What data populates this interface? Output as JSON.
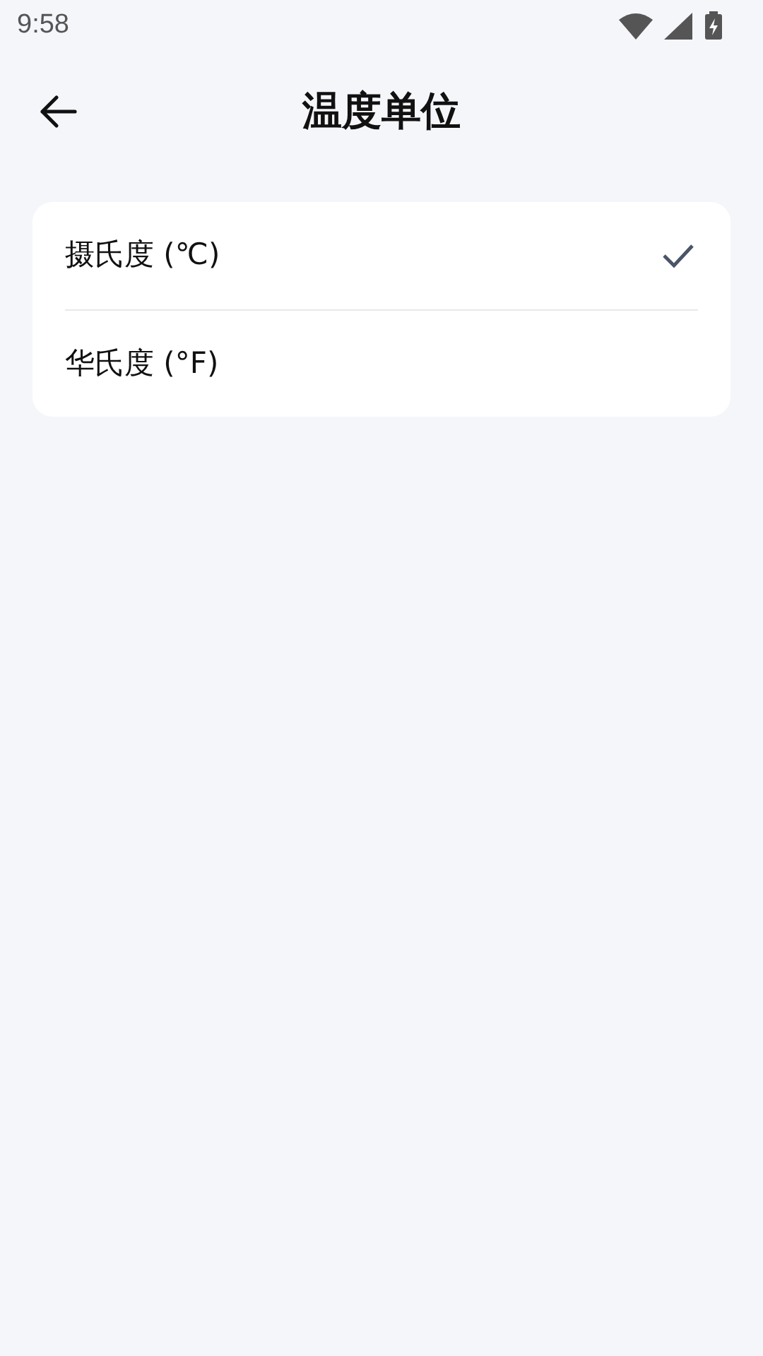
{
  "status_bar": {
    "time": "9:58"
  },
  "header": {
    "title": "温度单位"
  },
  "options": [
    {
      "label": "摄氏度 (℃)",
      "selected": true
    },
    {
      "label": "华氏度 (°F)",
      "selected": false
    }
  ]
}
